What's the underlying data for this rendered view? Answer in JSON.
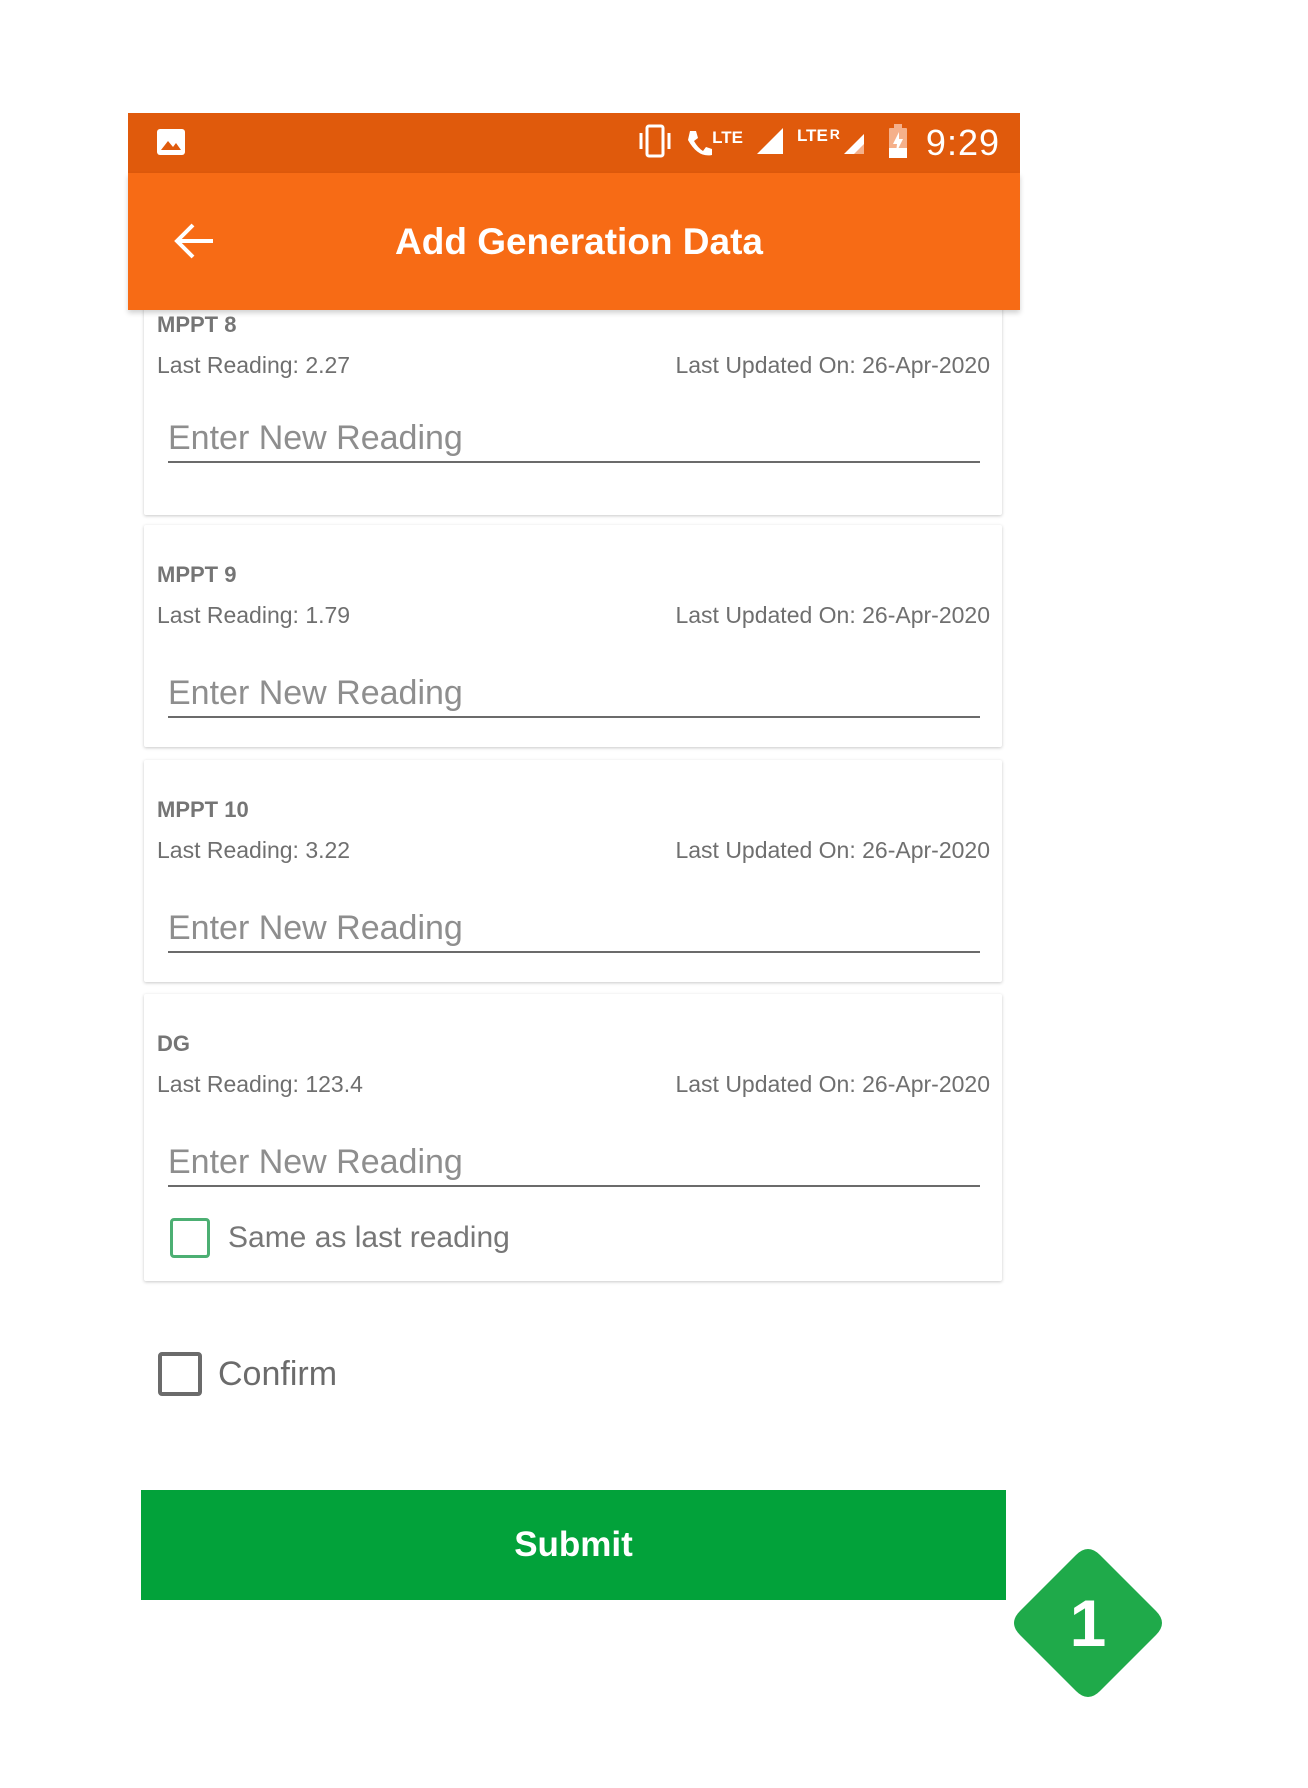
{
  "status_bar": {
    "network_1": "LTE",
    "network_2": "LTE",
    "roaming": "R",
    "time": "9:29"
  },
  "app_bar": {
    "title": "Add Generation Data"
  },
  "readings": [
    {
      "name": "MPPT 8",
      "last_reading": "Last Reading: 2.27",
      "last_updated": "Last Updated On: 26-Apr-2020",
      "placeholder": "Enter New Reading"
    },
    {
      "name": "MPPT 9",
      "last_reading": "Last Reading: 1.79",
      "last_updated": "Last Updated On: 26-Apr-2020",
      "placeholder": "Enter New Reading"
    },
    {
      "name": "MPPT 10",
      "last_reading": "Last Reading: 3.22",
      "last_updated": "Last Updated On: 26-Apr-2020",
      "placeholder": "Enter New Reading"
    },
    {
      "name": "DG",
      "last_reading": "Last Reading: 123.4",
      "last_updated": "Last Updated On: 26-Apr-2020",
      "placeholder": "Enter New Reading",
      "same_as_last_label": "Same as last reading"
    }
  ],
  "confirm_label": "Confirm",
  "submit_label": "Submit",
  "step_badge": "1",
  "colors": {
    "status_bar": "#e05a0c",
    "app_bar": "#f76b15",
    "submit": "#02a23a",
    "badge": "#1faa4a"
  }
}
